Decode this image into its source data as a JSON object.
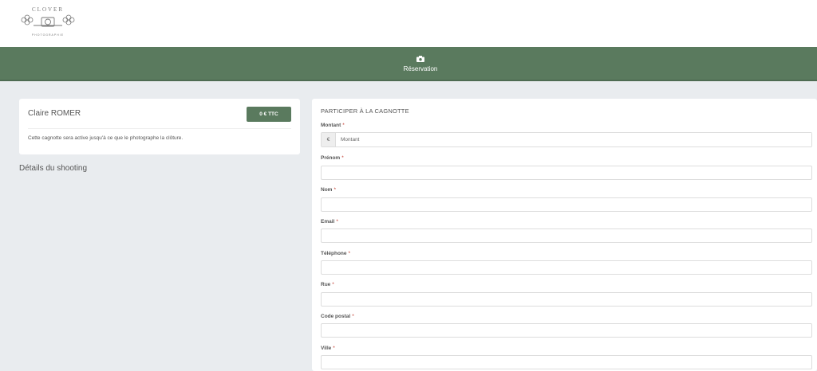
{
  "brand": {
    "logo_text": "CLOVER",
    "logo_subtext": "PHOTOGRAPHIE"
  },
  "nav": {
    "items": [
      {
        "label": "Réservation",
        "icon": "camera-icon"
      }
    ]
  },
  "summary": {
    "client_name": "Claire ROMER",
    "total_badge": "0 € TTC",
    "note": "Cette cagnotte sera active jusqu'à ce que le photographe la clôture."
  },
  "shooting": {
    "title": "Détails du shooting"
  },
  "form": {
    "title": "PARTICIPER À LA CAGNOTTE",
    "amount": {
      "label": "Montant",
      "required_mark": "*",
      "currency": "€",
      "placeholder": "Montant",
      "value": ""
    },
    "fields": [
      {
        "key": "prenom",
        "label": "Prénom",
        "required_mark": "*",
        "value": ""
      },
      {
        "key": "nom",
        "label": "Nom",
        "required_mark": "*",
        "value": ""
      },
      {
        "key": "email",
        "label": "Email",
        "required_mark": "*",
        "value": ""
      },
      {
        "key": "telephone",
        "label": "Téléphone",
        "required_mark": "*",
        "value": ""
      },
      {
        "key": "rue",
        "label": "Rue",
        "required_mark": "*",
        "value": ""
      },
      {
        "key": "code_postal",
        "label": "Code postal",
        "required_mark": "*",
        "value": ""
      },
      {
        "key": "ville",
        "label": "Ville",
        "required_mark": "*",
        "value": ""
      }
    ]
  },
  "colors": {
    "accent": "#5a7a5e",
    "background": "#e9ecef",
    "required": "#c0392b"
  }
}
